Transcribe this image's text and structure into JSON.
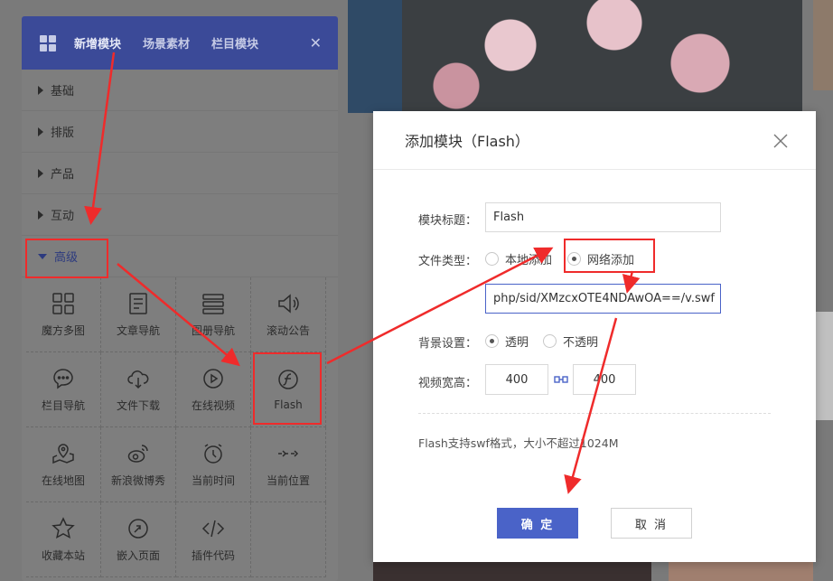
{
  "panel": {
    "tabs": [
      {
        "label": "新增模块",
        "active": true
      },
      {
        "label": "场景素材",
        "active": false
      },
      {
        "label": "栏目模块",
        "active": false
      }
    ],
    "categories": [
      "基础",
      "排版",
      "产品",
      "互动",
      "高级"
    ],
    "modules": [
      {
        "label": "魔方多图",
        "icon": "grid-image-icon"
      },
      {
        "label": "文章导航",
        "icon": "article-nav-icon"
      },
      {
        "label": "图册导航",
        "icon": "album-nav-icon"
      },
      {
        "label": "滚动公告",
        "icon": "speaker-icon"
      },
      {
        "label": "栏目导航",
        "icon": "chat-bubble-icon"
      },
      {
        "label": "文件下载",
        "icon": "cloud-download-icon"
      },
      {
        "label": "在线视频",
        "icon": "play-icon"
      },
      {
        "label": "Flash",
        "icon": "flash-icon"
      },
      {
        "label": "在线地图",
        "icon": "map-icon"
      },
      {
        "label": "新浪微博秀",
        "icon": "weibo-icon"
      },
      {
        "label": "当前时间",
        "icon": "clock-icon"
      },
      {
        "label": "当前位置",
        "icon": "location-arrows-icon"
      },
      {
        "label": "收藏本站",
        "icon": "star-icon"
      },
      {
        "label": "嵌入页面",
        "icon": "embed-icon"
      },
      {
        "label": "插件代码",
        "icon": "code-icon"
      }
    ]
  },
  "modal": {
    "title": "添加模块（Flash）",
    "title_label": "模块标题：",
    "title_value": "Flash",
    "file_type_label": "文件类型：",
    "file_type_options": [
      "本地添加",
      "网络添加"
    ],
    "url_value": "php/sid/XMzcxOTE4NDAwOA==/v.swf",
    "bg_label": "背景设置：",
    "bg_options": [
      "透明",
      "不透明"
    ],
    "size_label": "视频宽高：",
    "width": "400",
    "height": "400",
    "note": "Flash支持swf格式，大小不超过1024M",
    "ok": "确 定",
    "cancel": "取 消"
  },
  "colors": {
    "header": "#3b4a98",
    "primary": "#4a63c8",
    "annotation": "#ef2b2b"
  }
}
